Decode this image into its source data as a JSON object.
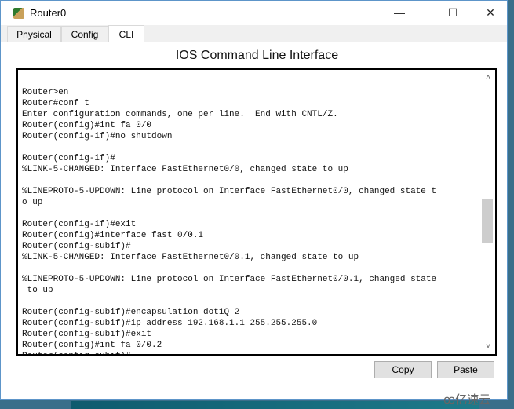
{
  "window": {
    "title": "Router0",
    "controls": {
      "minimize": "—",
      "maximize": "☐",
      "close": "✕"
    }
  },
  "tabs": [
    {
      "label": "Physical"
    },
    {
      "label": "Config"
    },
    {
      "label": "CLI",
      "active": true
    }
  ],
  "heading": "IOS Command Line Interface",
  "terminal": {
    "lines": [
      "",
      "Router>en",
      "Router#conf t",
      "Enter configuration commands, one per line.  End with CNTL/Z.",
      "Router(config)#int fa 0/0",
      "Router(config-if)#no shutdown",
      "",
      "Router(config-if)#",
      "%LINK-5-CHANGED: Interface FastEthernet0/0, changed state to up",
      "",
      "%LINEPROTO-5-UPDOWN: Line protocol on Interface FastEthernet0/0, changed state t",
      "o up",
      "",
      "Router(config-if)#exit",
      "Router(config)#interface fast 0/0.1",
      "Router(config-subif)#",
      "%LINK-5-CHANGED: Interface FastEthernet0/0.1, changed state to up",
      "",
      "%LINEPROTO-5-UPDOWN: Line protocol on Interface FastEthernet0/0.1, changed state",
      " to up",
      "",
      "Router(config-subif)#encapsulation dot1Q 2",
      "Router(config-subif)#ip address 192.168.1.1 255.255.255.0",
      "Router(config-subif)#exit",
      "Router(config)#int fa 0/0.2",
      "Router(config-subif)#"
    ],
    "scroll_position_percent": 60
  },
  "buttons": {
    "copy": "Copy",
    "paste": "Paste"
  },
  "watermark": "亿速云"
}
